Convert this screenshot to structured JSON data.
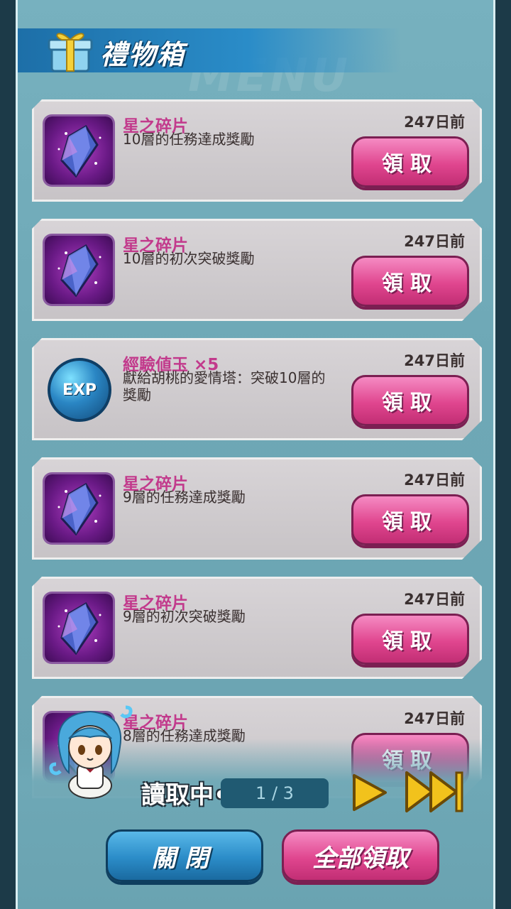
{
  "header": {
    "title": "禮物箱"
  },
  "gifts": [
    {
      "title": "星之碎片",
      "desc": "10層的任務達成獎勵",
      "time": "247日前",
      "icon": "star-shard-icon"
    },
    {
      "title": "星之碎片",
      "desc": "10層的初次突破獎勵",
      "time": "247日前",
      "icon": "star-shard-icon"
    },
    {
      "title": "經驗値玉 ×5",
      "desc": "獻給胡桃的愛情塔：突破10層的獎勵",
      "time": "247日前",
      "icon": "exp-orb-icon",
      "icon_label": "EXP"
    },
    {
      "title": "星之碎片",
      "desc": "9層的任務達成獎勵",
      "time": "247日前",
      "icon": "star-shard-icon"
    },
    {
      "title": "星之碎片",
      "desc": "9層的初次突破獎勵",
      "time": "247日前",
      "icon": "star-shard-icon"
    },
    {
      "title": "星之碎片",
      "desc": "8層的任務達成獎勵",
      "time": "247日前",
      "icon": "star-shard-icon"
    }
  ],
  "claim_label": "領取",
  "footer": {
    "loading_text": "讀取中•••",
    "page_indicator": "1 / 3",
    "close_label": "關閉",
    "claim_all_label": "全部領取"
  },
  "colors": {
    "accent_pink": "#e0468f",
    "accent_blue": "#2b8cc8",
    "title_pink": "#c23a8c"
  }
}
